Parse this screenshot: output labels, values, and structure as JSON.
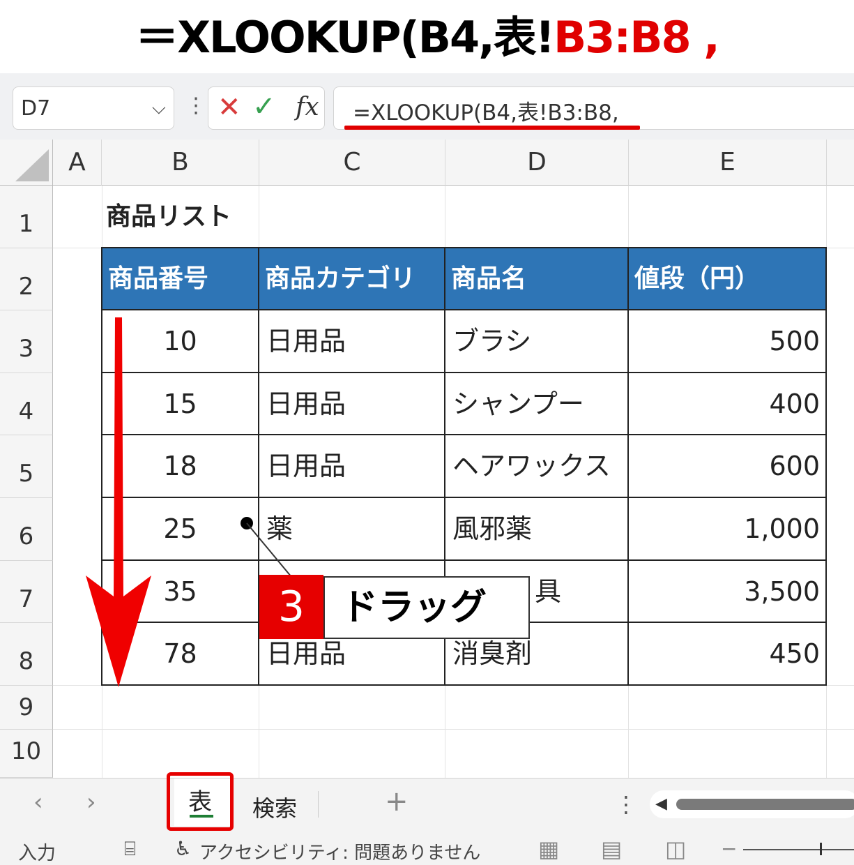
{
  "title": {
    "prefix": "＝XLOOKUP(B4,表!",
    "highlight": "B3:B8 ,"
  },
  "formula_bar": {
    "name_box": "D7",
    "formula": "=XLOOKUP(B4,表!B3:B8,",
    "cancel_icon": "✕",
    "enter_icon": "✓",
    "fx_icon": "fx"
  },
  "columns": [
    "A",
    "B",
    "C",
    "D",
    "E"
  ],
  "rows": [
    "1",
    "2",
    "3",
    "4",
    "5",
    "6",
    "7",
    "8",
    "9",
    "10"
  ],
  "sheet": {
    "list_title": "商品リスト",
    "headers": [
      "商品番号",
      "商品カテゴリ",
      "商品名",
      "値段（円）"
    ],
    "data": [
      {
        "id": "10",
        "category": "日用品",
        "name": "ブラシ",
        "price": "500"
      },
      {
        "id": "15",
        "category": "日用品",
        "name": "シャンプー",
        "price": "400"
      },
      {
        "id": "18",
        "category": "日用品",
        "name": "ヘアワックス",
        "price": "600"
      },
      {
        "id": "25",
        "category": "薬",
        "name": "風邪薬",
        "price": "1,000"
      },
      {
        "id": "35",
        "category": "",
        "name": "具",
        "price": "3,500"
      },
      {
        "id": "78",
        "category": "日用品",
        "name": "消臭剤",
        "price": "450"
      }
    ]
  },
  "callout": {
    "step": "3",
    "label": "ドラッグ"
  },
  "tabs": {
    "prev": "‹",
    "next": "›",
    "active": "表",
    "other": "検索",
    "add": "+",
    "menu": "⋮"
  },
  "status": {
    "mode": "入力",
    "accessibility": "アクセシビリティ: 問題ありません"
  },
  "colors": {
    "accent_red": "#e00000",
    "table_header": "#2e75b6",
    "excel_green": "#1e7e34"
  }
}
